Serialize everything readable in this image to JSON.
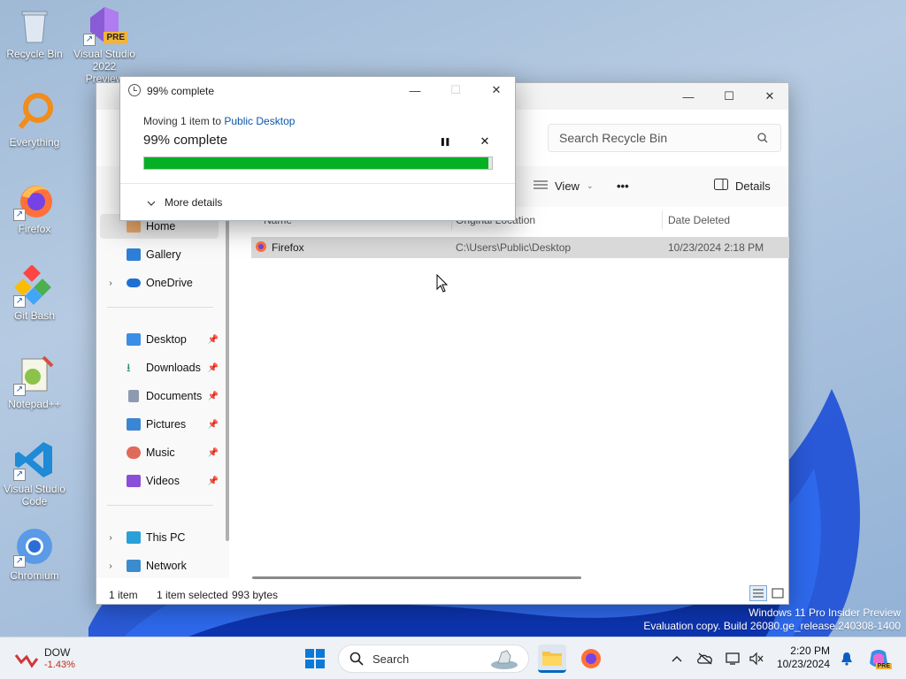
{
  "desktop": {
    "icons": [
      {
        "label": "Recycle Bin"
      },
      {
        "label": "Visual Studio 2022 Preview",
        "badge": "PRE"
      },
      {
        "label": "Everything"
      },
      {
        "label": "Firefox"
      },
      {
        "label": "Git Bash"
      },
      {
        "label": "Notepad++"
      },
      {
        "label": "Visual Studio Code"
      },
      {
        "label": "Chromium"
      }
    ]
  },
  "explorer": {
    "search_placeholder": "Search Recycle Bin",
    "toolbar": {
      "view": "View",
      "more": "•••",
      "details": "Details"
    },
    "sidebar": {
      "items": [
        {
          "label": "Home",
          "icon": "home-icon"
        },
        {
          "label": "Gallery",
          "icon": "gallery-icon"
        },
        {
          "label": "OneDrive",
          "icon": "cloud-icon"
        },
        {
          "label": "Desktop",
          "icon": "desktop-icon"
        },
        {
          "label": "Downloads",
          "icon": "download-icon"
        },
        {
          "label": "Documents",
          "icon": "document-icon"
        },
        {
          "label": "Pictures",
          "icon": "picture-icon"
        },
        {
          "label": "Music",
          "icon": "music-icon"
        },
        {
          "label": "Videos",
          "icon": "video-icon"
        },
        {
          "label": "This PC",
          "icon": "pc-icon"
        },
        {
          "label": "Network",
          "icon": "network-icon"
        }
      ]
    },
    "columns": {
      "name": "Name",
      "location": "Original Location",
      "date": "Date Deleted"
    },
    "rows": [
      {
        "name": "Firefox",
        "location": "C:\\Users\\Public\\Desktop",
        "date": "10/23/2024 2:18 PM"
      }
    ],
    "status": {
      "count": "1 item",
      "selected": "1 item selected",
      "size": "993 bytes"
    }
  },
  "dialog": {
    "title": "99% complete",
    "moving_prefix": "Moving 1 item to ",
    "destination": "Public Desktop",
    "percent_text": "99% complete",
    "progress": 0.99,
    "pause_label": "❚❚",
    "cancel_label": "✕",
    "more_details": "More details"
  },
  "watermark": {
    "line1": "Windows 11 Pro Insider Preview",
    "line2": "Evaluation copy. Build 26080.ge_release.240308-1400"
  },
  "taskbar": {
    "widget_title": "DOW",
    "widget_value": "-1.43%",
    "search_label": "Search",
    "time": "2:20 PM",
    "date": "10/23/2024",
    "copilot_badge": "PRE"
  },
  "colors": {
    "accent": "#0067c0",
    "progress": "#06b025",
    "selection": "#d9d9d9"
  }
}
